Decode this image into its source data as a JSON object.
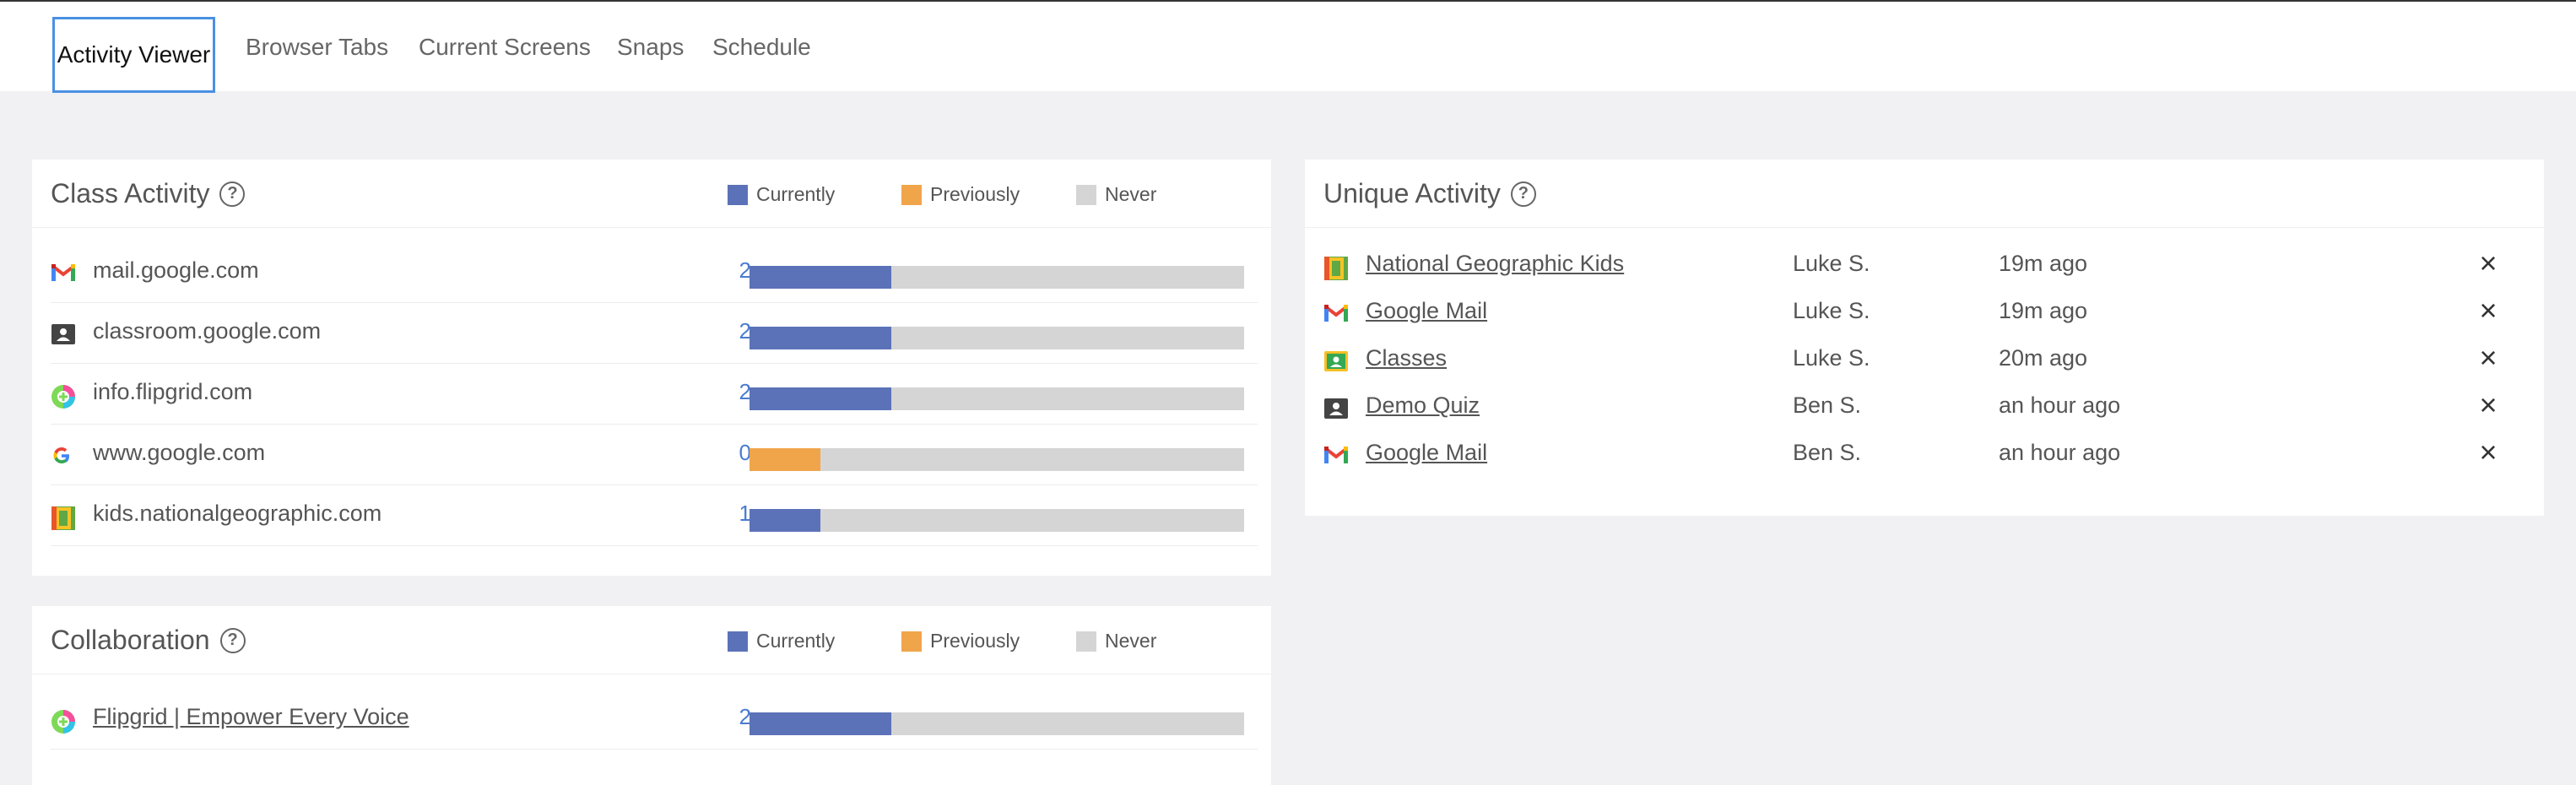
{
  "tabs": [
    {
      "label": "Activity Viewer",
      "active": true
    },
    {
      "label": "Browser Tabs"
    },
    {
      "label": "Current Screens"
    },
    {
      "label": "Snaps"
    },
    {
      "label": "Schedule"
    }
  ],
  "colors": {
    "currently": "#5b72b8",
    "previously": "#f0a54a",
    "never": "#d5d5d5"
  },
  "legend": {
    "currently": "Currently",
    "previously": "Previously",
    "never": "Never"
  },
  "class_activity": {
    "title": "Class Activity",
    "help": "?",
    "rows": [
      {
        "icon": "gmail-icon",
        "label": "mail.google.com",
        "count": "2",
        "current_fraction": 0.287,
        "previous_fraction": 0
      },
      {
        "icon": "classroom-icon",
        "label": "classroom.google.com",
        "count": "2",
        "current_fraction": 0.287,
        "previous_fraction": 0
      },
      {
        "icon": "flipgrid-icon",
        "label": "info.flipgrid.com",
        "count": "2",
        "current_fraction": 0.287,
        "previous_fraction": 0
      },
      {
        "icon": "google-icon",
        "label": "www.google.com",
        "count": "0",
        "current_fraction": 0,
        "previous_fraction": 0.143
      },
      {
        "icon": "natgeo-icon",
        "label": "kids.nationalgeographic.com",
        "count": "1",
        "current_fraction": 0.143,
        "previous_fraction": 0
      }
    ]
  },
  "collaboration": {
    "title": "Collaboration",
    "help": "?",
    "rows": [
      {
        "icon": "flipgrid-icon",
        "label": "Flipgrid | Empower Every Voice",
        "count": "2",
        "current_fraction": 0.287,
        "previous_fraction": 0
      }
    ]
  },
  "unique_activity": {
    "title": "Unique Activity",
    "help": "?",
    "rows": [
      {
        "icon": "natgeo-icon",
        "name": "National Geographic Kids",
        "student": "Luke S.",
        "time": "19m ago"
      },
      {
        "icon": "gmail-icon",
        "name": "Google Mail",
        "student": "Luke S.",
        "time": "19m ago"
      },
      {
        "icon": "classes-icon",
        "name": "Classes",
        "student": "Luke S.",
        "time": "20m ago"
      },
      {
        "icon": "classroom-icon",
        "name": "Demo Quiz",
        "student": "Ben S.",
        "time": "an hour ago"
      },
      {
        "icon": "gmail-icon",
        "name": "Google Mail",
        "student": "Ben S.",
        "time": "an hour ago"
      }
    ],
    "close_glyph": "×"
  }
}
